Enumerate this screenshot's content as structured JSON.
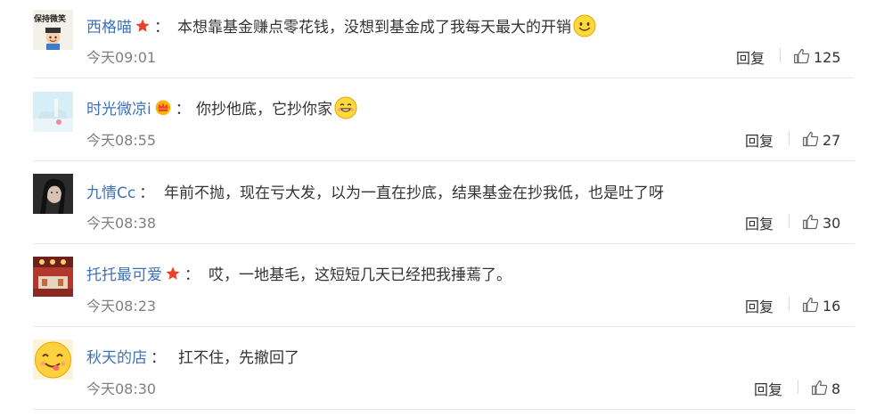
{
  "comments": [
    {
      "username": "西格喵",
      "badge": "star-badge",
      "colon": "：",
      "text": "本想靠基金赚点零花钱，没想到基金成了我每天最大的开销",
      "emoji": "smile-emoji",
      "time": "今天09:01",
      "reply_label": "回复",
      "likes": "125",
      "avatar_text": "保持微笑"
    },
    {
      "username": "时光微凉i",
      "badge": "crown-badge",
      "colon": "：",
      "text": "你抄他底，它抄你家",
      "emoji": "grin-emoji",
      "time": "今天08:55",
      "reply_label": "回复",
      "likes": "27"
    },
    {
      "username": "九情Cc",
      "badge": "",
      "colon": "：",
      "text": "年前不抛，现在亏大发，以为一直在抄底，结果基金在抄我低，也是吐了呀",
      "time": "今天08:38",
      "reply_label": "回复",
      "likes": "30"
    },
    {
      "username": "托托最可爱",
      "badge": "star-badge",
      "colon": "：",
      "text": "哎，一地基毛，这短短几天已经把我捶蔫了。",
      "time": "今天08:23",
      "reply_label": "回复",
      "likes": "16"
    },
    {
      "username": "秋天的店",
      "badge": "",
      "colon": "：",
      "text": "扛不住，先撤回了",
      "time": "今天08:30",
      "reply_label": "回复",
      "likes": "8"
    }
  ],
  "colors": {
    "username": "#3d72b8",
    "text": "#333333",
    "time": "#808080",
    "badge_star": "#e8412c",
    "divider": "#e8e8e8"
  }
}
